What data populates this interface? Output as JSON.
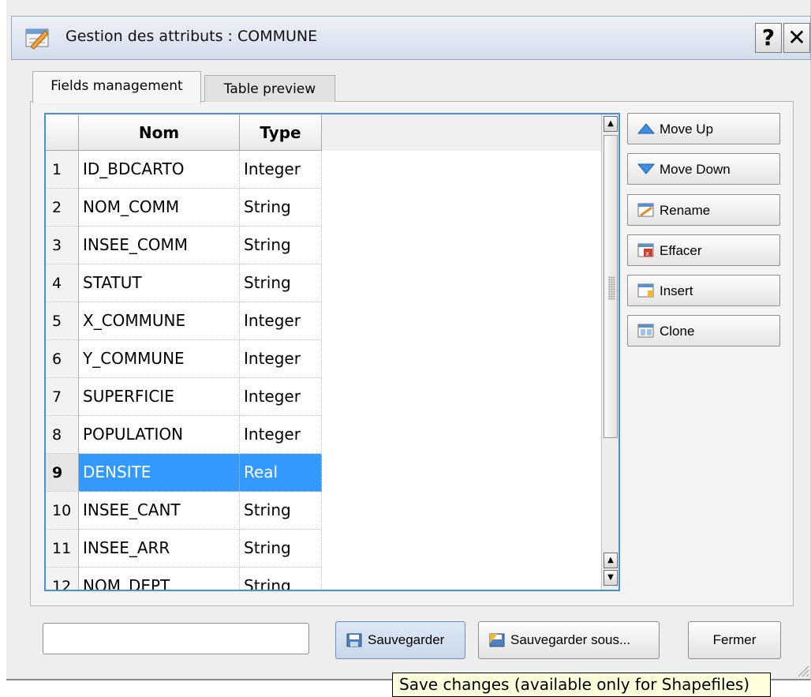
{
  "window": {
    "title": "Gestion des attributs : COMMUNE",
    "help_label": "?",
    "close_label": "✕"
  },
  "tabs": [
    {
      "label": "Fields management",
      "active": true
    },
    {
      "label": "Table preview",
      "active": false
    }
  ],
  "table": {
    "columns": [
      "Nom",
      "Type"
    ],
    "rows": [
      {
        "num": "1",
        "nom": "ID_BDCARTO",
        "type": "Integer"
      },
      {
        "num": "2",
        "nom": "NOM_COMM",
        "type": "String"
      },
      {
        "num": "3",
        "nom": "INSEE_COMM",
        "type": "String"
      },
      {
        "num": "4",
        "nom": "STATUT",
        "type": "String"
      },
      {
        "num": "5",
        "nom": "X_COMMUNE",
        "type": "Integer"
      },
      {
        "num": "6",
        "nom": "Y_COMMUNE",
        "type": "Integer"
      },
      {
        "num": "7",
        "nom": "SUPERFICIE",
        "type": "Integer"
      },
      {
        "num": "8",
        "nom": "POPULATION",
        "type": "Integer"
      },
      {
        "num": "9",
        "nom": "DENSITE",
        "type": "Real",
        "selected": true
      },
      {
        "num": "10",
        "nom": "INSEE_CANT",
        "type": "String"
      },
      {
        "num": "11",
        "nom": "INSEE_ARR",
        "type": "String"
      },
      {
        "num": "12",
        "nom": "NOM_DEPT",
        "type": "String"
      }
    ]
  },
  "side_buttons": {
    "move_up": "Move Up",
    "move_down": "Move Down",
    "rename": "Rename",
    "effacer": "Effacer",
    "insert": "Insert",
    "clone": "Clone"
  },
  "footer": {
    "input_value": "",
    "save": "Sauvegarder",
    "save_as": "Sauvegarder sous...",
    "close": "Fermer"
  },
  "tooltip": "Save changes (available only for Shapefiles)",
  "colors": {
    "selection": "#3399ff",
    "focus_border": "#4a90d8",
    "tooltip_bg": "#ffffdc"
  }
}
